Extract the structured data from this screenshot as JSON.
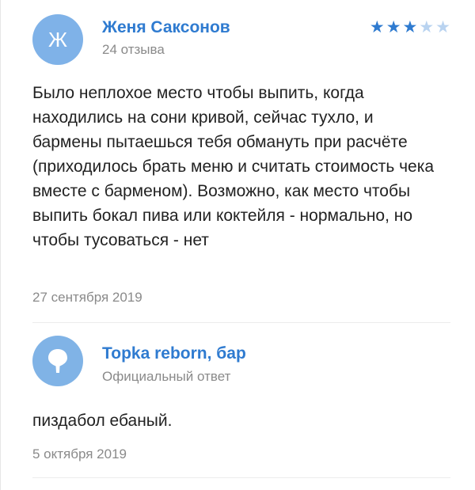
{
  "review": {
    "avatar_letter": "Ж",
    "author": "Женя Саксонов",
    "reviews_count": "24 отзыва",
    "rating": 3,
    "rating_max": 5,
    "text": "Было неплохое место чтобы выпить, когда находились на сони кривой, сейчас тухло, и бармены пытаешься тебя обмануть при расчёте (приходилось брать меню и считать стоимость чека вместе с барменом). Возможно, как место чтобы выпить бокал пива или коктейля - нормально, но чтобы тусоваться - нет",
    "date": "27 сентября 2019"
  },
  "reply": {
    "author": "Topka reborn, бар",
    "label": "Официальный ответ",
    "avatar_icon": "pin-icon",
    "text": "пиздабол ебаный.",
    "date": "5 октября 2019"
  },
  "colors": {
    "accent": "#2f7bd0",
    "avatar_bg": "#7fb2e8",
    "muted_text": "#8a8a8a",
    "star_empty": "#b9d3f0"
  }
}
